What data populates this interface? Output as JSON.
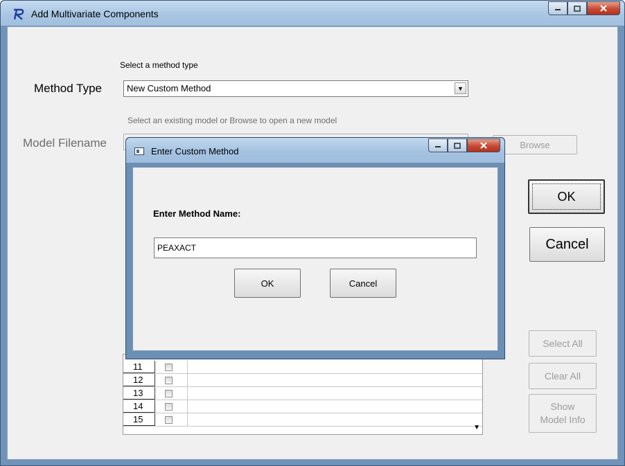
{
  "window": {
    "title": "Add Multivariate Components"
  },
  "method_type": {
    "hint": "Select a method type",
    "label": "Method Type",
    "value": "New Custom Method"
  },
  "model_filename": {
    "hint": "Select an existing model or Browse to open a new model",
    "label": "Model Filename",
    "browse_label": "Browse"
  },
  "buttons": {
    "ok": "OK",
    "cancel": "Cancel",
    "select_all": "Select All",
    "clear_all": "Clear All",
    "show_model_info_line1": "Show",
    "show_model_info_line2": "Model Info"
  },
  "list": {
    "rows": [
      "11",
      "12",
      "13",
      "14",
      "15"
    ]
  },
  "dialog": {
    "title": "Enter Custom Method",
    "prompt": "Enter Method Name:",
    "input_value": "PEAXACT",
    "ok_label": "OK",
    "cancel_label": "Cancel"
  },
  "colors": {
    "title_bar": "#a9c7e4",
    "frame": "#6f93b9",
    "close_button": "#c64a34",
    "client_bg": "#f0f0f0"
  }
}
